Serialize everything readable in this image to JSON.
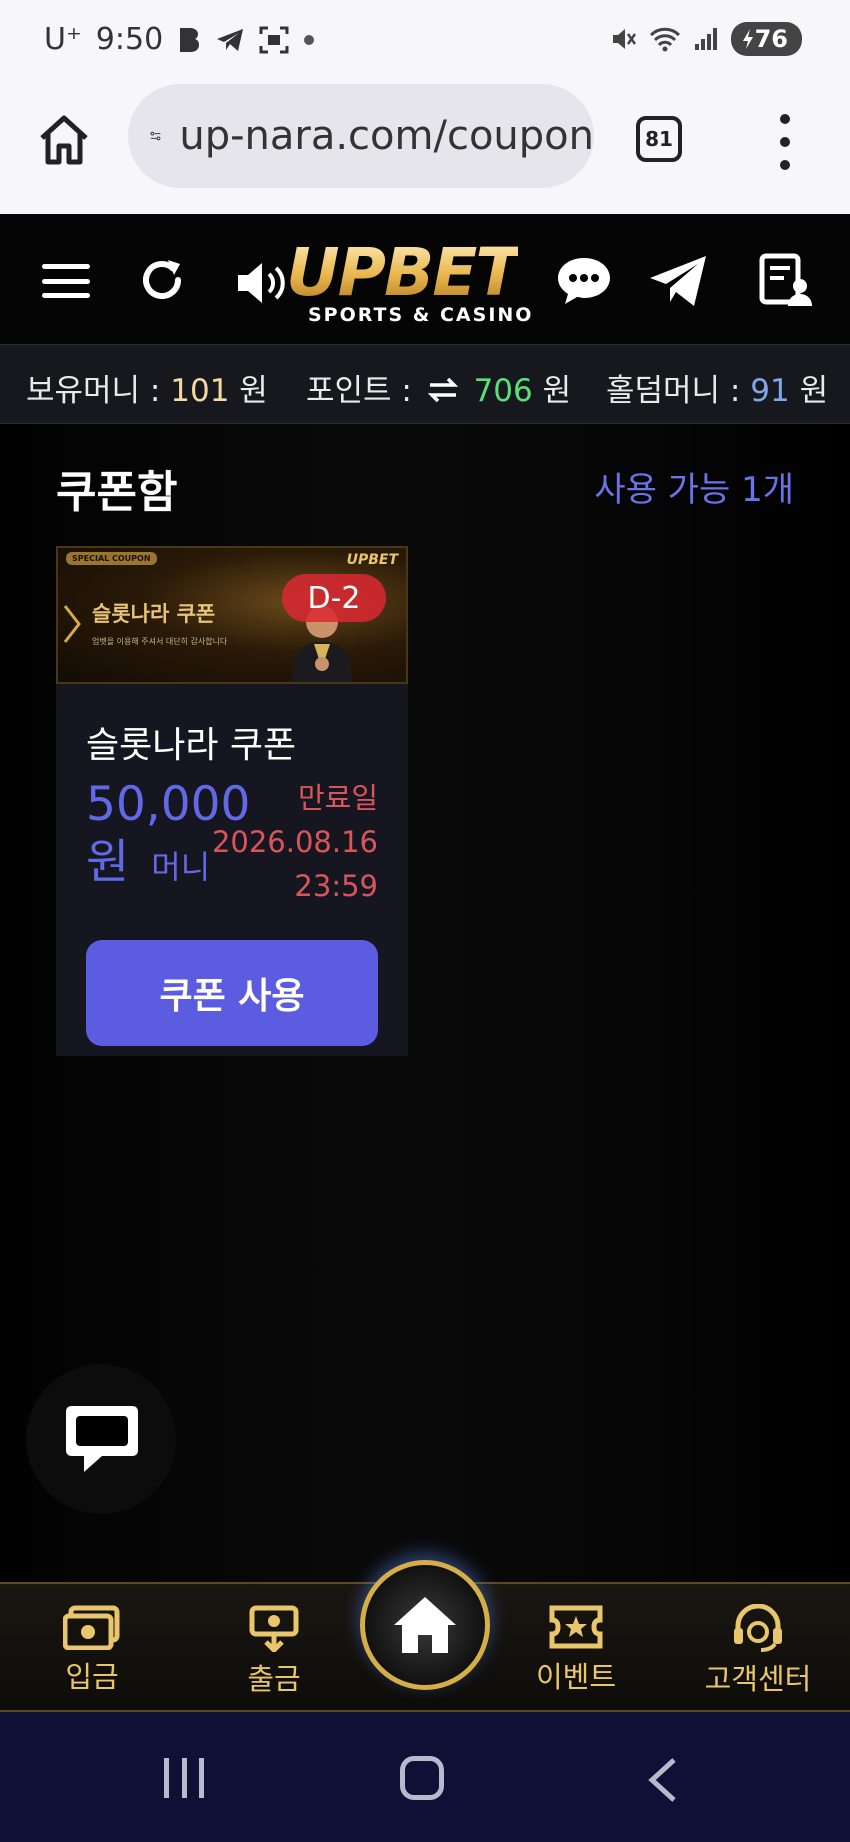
{
  "status_bar": {
    "carrier": "U⁺",
    "time": "9:50",
    "battery": "76"
  },
  "browser": {
    "url": "up-nara.com/coupon",
    "tab_count": "81"
  },
  "header": {
    "logo_text": "UPBET",
    "logo_subtitle": "SPORTS & CASINO"
  },
  "balances": {
    "money_label": "보유머니 :",
    "money_value": "101",
    "money_unit": "원",
    "point_label": "포인트 :",
    "point_value": "706",
    "point_unit": "원",
    "holdem_label": "홀덤머니 :",
    "holdem_value": "91",
    "holdem_unit": "원"
  },
  "coupons": {
    "title": "쿠폰함",
    "available": "사용 가능 1개",
    "items": [
      {
        "banner_tag": "SPECIAL COUPON",
        "banner_title": "슬롯나라 쿠폰",
        "banner_subtitle": "업벳을 이용해 주셔서 대단히 감사합니다",
        "banner_logo": "UPBET",
        "d_day": "D-2",
        "name": "슬롯나라 쿠폰",
        "amount": "50,000",
        "amount_unit": "원",
        "amount_type": "머니",
        "expire_label": "만료일",
        "expire_date": "2026.08.16",
        "expire_time": "23:59",
        "use_button": "쿠폰 사용"
      }
    ]
  },
  "bottom_nav": {
    "deposit": "입금",
    "withdraw": "출금",
    "event": "이벤트",
    "support": "고객센터"
  },
  "colors": {
    "accent": "#5b5ce0",
    "gold": "#e9c56b",
    "expire_red": "#d9555c",
    "points_green": "#58e07a"
  }
}
